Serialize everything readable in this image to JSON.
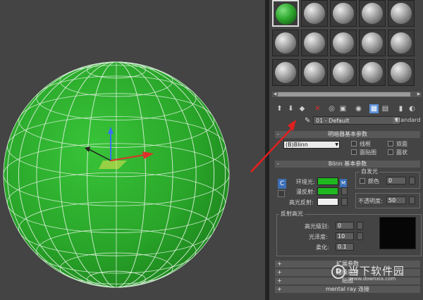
{
  "material_slots": {
    "count": 15,
    "selected_index": 0,
    "selected_color": "#2ea82e"
  },
  "toolbar": {
    "icons": [
      "get-material-icon",
      "put-to-scene-icon",
      "assign-to-selection-icon",
      "reset-map-icon",
      "make-unique-icon",
      "put-to-library-icon",
      "material-id-icon",
      "show-in-viewport-icon",
      "show-end-result-icon",
      "go-to-parent-icon",
      "go-forward-icon"
    ],
    "active_icon": "show-in-viewport-icon"
  },
  "material": {
    "name": "01 - Default",
    "type": "Standard"
  },
  "shader_basic": {
    "title": "明暗器基本参数",
    "shader": "(B)Blinn",
    "wire": "线框",
    "two_sided": "双面",
    "face_map": "面贴图",
    "faceted": "面状"
  },
  "blinn_basic": {
    "title": "Blinn 基本参数",
    "ambient": "环境光:",
    "diffuse": "漫反射:",
    "specular": "高光反射:",
    "self_illum": "自发光",
    "color": "颜色",
    "self_illum_value": "0",
    "opacity_label": "不透明度:",
    "opacity_value": "50",
    "lock_letter": "C",
    "map_letter": "M",
    "ambient_color": "#1fb81f",
    "diffuse_color": "#1fb81f",
    "specular_color": "#f0f0f0"
  },
  "specular_highlights": {
    "title": "反射高光",
    "level_label": "高光级别:",
    "level_value": "0",
    "gloss_label": "光泽度:",
    "gloss_value": "10",
    "soften_label": "柔化:",
    "soften_value": "0.1"
  },
  "rollouts": [
    {
      "label": "扩展参数"
    },
    {
      "label": "超级采样"
    },
    {
      "label": "贴图"
    },
    {
      "label": "mental ray 连接"
    }
  ],
  "watermark": {
    "logo": "D",
    "text": "当下软件园",
    "url": "www.downxia.com"
  },
  "colors": {
    "sphere_fill": "#2faa2f",
    "wire": "#cfeacf",
    "arrow": "#e02020",
    "panel_bg": "#444444"
  }
}
